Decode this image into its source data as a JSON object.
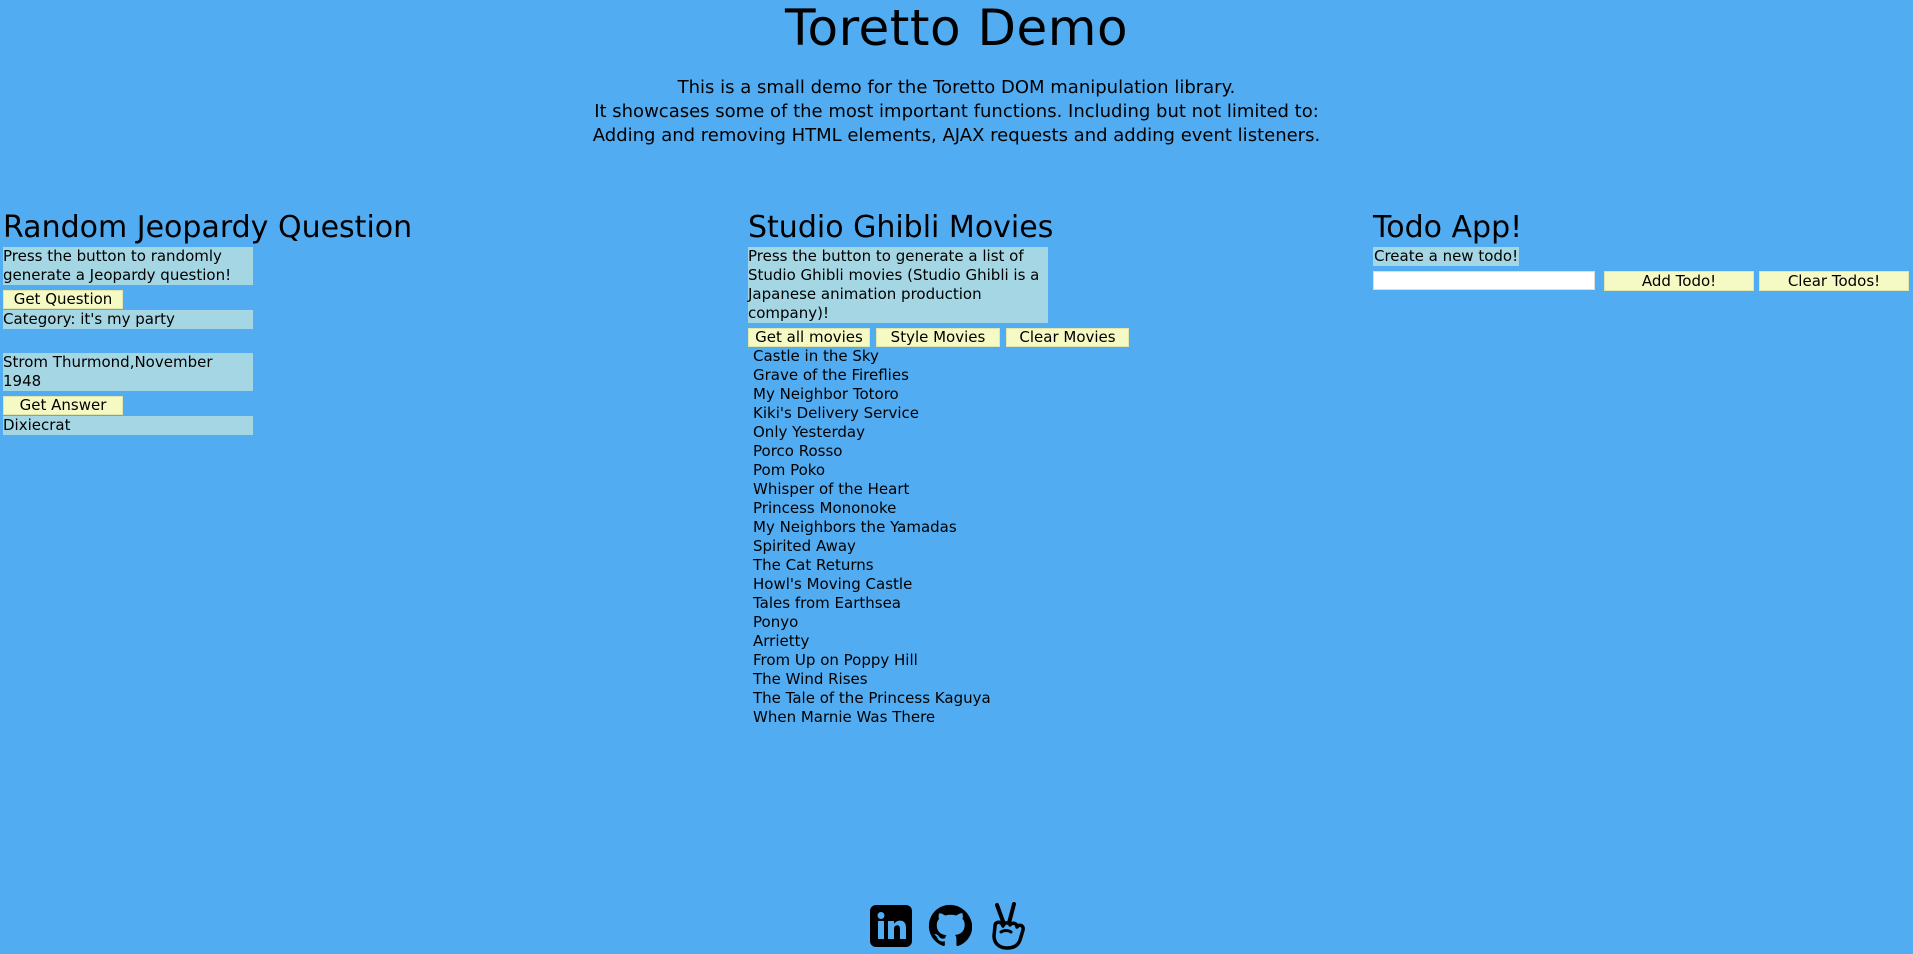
{
  "header": {
    "title": "Toretto Demo",
    "intro_lines": [
      "This is a small demo for the Toretto DOM manipulation library.",
      "It showcases some of the most important functions. Including but not limited to:",
      "Adding and removing HTML elements, AJAX requests and adding event listeners."
    ]
  },
  "jeopardy": {
    "title": "Random Jeopardy Question",
    "prompt": "Press the button to randomly generate a Jeopardy question!",
    "question_button": "Get Question",
    "category": "Category: it's my party",
    "question": "Strom Thurmond,November 1948",
    "answer_button": "Get Answer",
    "answer": "Dixiecrat"
  },
  "ghibli": {
    "title": "Studio Ghibli Movies",
    "prompt": "Press the button to generate a list of Studio Ghibli movies (Studio Ghibli is a Japanese animation production company)!",
    "buttons": {
      "get_all": "Get all movies",
      "style": "Style Movies",
      "clear": "Clear Movies"
    },
    "movies": [
      "Castle in the Sky",
      "Grave of the Fireflies",
      "My Neighbor Totoro",
      "Kiki's Delivery Service",
      "Only Yesterday",
      "Porco Rosso",
      "Pom Poko",
      "Whisper of the Heart",
      "Princess Mononoke",
      "My Neighbors the Yamadas",
      "Spirited Away",
      "The Cat Returns",
      "Howl's Moving Castle",
      "Tales from Earthsea",
      "Ponyo",
      "Arrietty",
      "From Up on Poppy Hill",
      "The Wind Rises",
      "The Tale of the Princess Kaguya",
      "When Marnie Was There"
    ]
  },
  "todo": {
    "title": "Todo App!",
    "prompt": "Create a new todo!",
    "input_value": "",
    "add_button": "Add Todo!",
    "clear_button": "Clear Todos!"
  },
  "footer": {
    "icons": [
      "linkedin-icon",
      "github-icon",
      "peace-hand-icon"
    ]
  },
  "colors": {
    "background": "#52acf2",
    "note_background": "#a4d6e4",
    "button_background": "#f5f9c3"
  }
}
